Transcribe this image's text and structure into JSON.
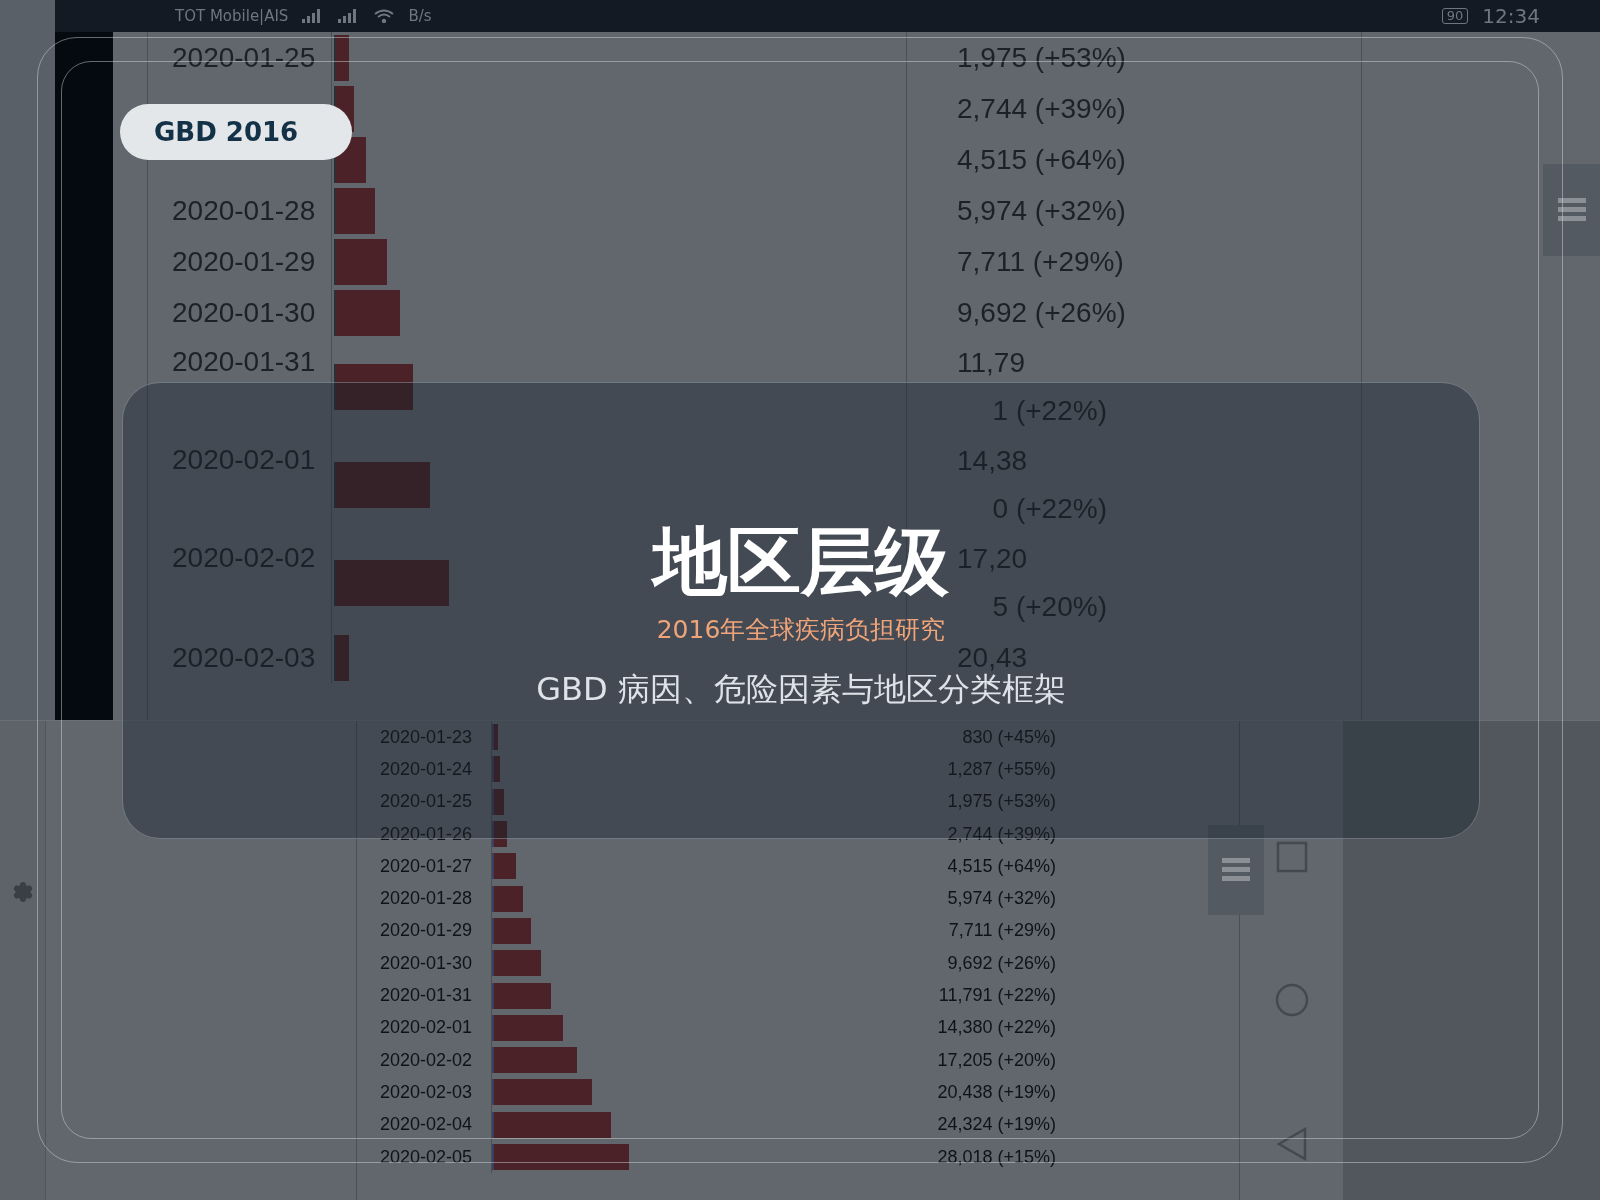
{
  "status_bar": {
    "carrier": "TOT Mobile|AIS",
    "speed": "B/s",
    "battery": "90",
    "time": "12:34"
  },
  "badge": "GBD 2016",
  "title_card": {
    "title": "地区层级",
    "subtitle": "2016年全球疾病负担研究",
    "caption": "GBD 病因、危险因素与地区分类框架"
  },
  "upper_list": [
    {
      "date": "2020-01-25",
      "value": [
        "1,975 (+53%)"
      ]
    },
    {
      "value": [
        "2,744 (+39%)"
      ]
    },
    {
      "value": [
        "4,515 (+64%)"
      ]
    },
    {
      "date": "2020-01-28",
      "value": [
        "5,974 (+32%)"
      ]
    },
    {
      "date": "2020-01-29",
      "value": [
        "7,711 (+29%)"
      ]
    },
    {
      "date": "2020-01-30",
      "value": [
        "9,692 (+26%)"
      ]
    },
    {
      "date": "2020-01-31",
      "value": [
        "11,79",
        "1 (+22%)"
      ]
    },
    {
      "date": "2020-02-01",
      "value": [
        "14,38",
        "0 (+22%)"
      ]
    },
    {
      "date": "2020-02-02",
      "value": [
        "17,20",
        "5 (+20%)"
      ]
    },
    {
      "date": "2020-02-03",
      "value": [
        "20,43"
      ]
    }
  ],
  "lower_list": [
    {
      "date": "2020-01-23",
      "value": "830 (+45%)"
    },
    {
      "date": "2020-01-24",
      "value": "1,287 (+55%)"
    },
    {
      "date": "2020-01-25",
      "value": "1,975 (+53%)"
    },
    {
      "date": "2020-01-26",
      "value": "2,744 (+39%)"
    },
    {
      "date": "2020-01-27",
      "value": "4,515 (+64%)"
    },
    {
      "date": "2020-01-28",
      "value": "5,974 (+32%)"
    },
    {
      "date": "2020-01-29",
      "value": "7,711 (+29%)"
    },
    {
      "date": "2020-01-30",
      "value": "9,692 (+26%)"
    },
    {
      "date": "2020-01-31",
      "value": "11,791 (+22%)"
    },
    {
      "date": "2020-02-01",
      "value": "14,380 (+22%)"
    },
    {
      "date": "2020-02-02",
      "value": "17,205 (+20%)"
    },
    {
      "date": "2020-02-03",
      "value": "20,438 (+19%)"
    },
    {
      "date": "2020-02-04",
      "value": "24,324 (+19%)"
    },
    {
      "date": "2020-02-05",
      "value": "28,018 (+15%)"
    }
  ]
}
